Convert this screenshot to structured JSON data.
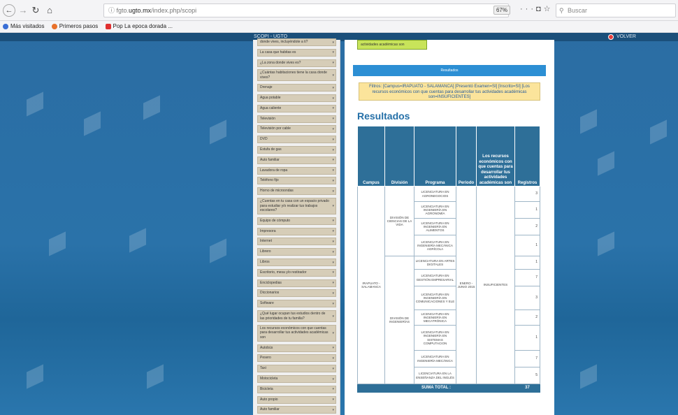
{
  "browser": {
    "url_prefix": "fgto.",
    "url_host": "ugto.mx",
    "url_path": "/index.php/scopi",
    "zoom": "67%",
    "search_placeholder": "Buscar",
    "bookmarks": [
      {
        "label": "Más visitados",
        "color": "#3a6fd6"
      },
      {
        "label": "Primeros pasos",
        "color": "#e8712a"
      },
      {
        "label": "Pop La epoca dorada ...",
        "color": "#e03030"
      }
    ]
  },
  "site": {
    "brand": "SCOPI - UGTO",
    "back_label": "VOLVER"
  },
  "filters": [
    "donde vives, incluyéndote a ti?",
    "La casa que habitas es",
    "¿La zona donde vives es?",
    "¿Cuántas habitaciones tiene la casa donde vives?",
    "Drenaje",
    "Agua potable",
    "Agua caliente",
    "Televisión",
    "Televisión por cable",
    "DVD",
    "Estufa de gas",
    "Auto familiar",
    "Lavadora de ropa",
    "Teléfono fijo",
    "Horno de microondas",
    "¿Cuentas en tu casa con un espacio privado para estudiar y/o realizar tus trabajos escolares?",
    "Equipo de cómputo",
    "Impresora",
    "Internet",
    "Librero",
    "Libros",
    "Escritorio, mesa y/o restirador",
    "Enciclopedias",
    "Diccionarios",
    "Software",
    "¿Qué lugar ocupan tus estudios dentro de las prioridades de tu familia?",
    "Los recursos económicos con que cuentas para desarrollar tus actividades académicas son",
    "Autobús",
    "Pesero",
    "Taxi",
    "Motocicleta",
    "Bicicleta",
    "Auto propio",
    "Auto familiar"
  ],
  "main": {
    "green_box_text": "actividades académicas son",
    "results_header": "Resultados",
    "filter_text": "Filtros: [Campus=IRAPUATO - SALAMANCA] [Presentó Examen=SI] [Inscrito=SI] [Los recursos económicos con que cuentas para desarrollar tus actividades académicas son=INSUFICIENTES]",
    "results_title": "Resultados",
    "table": {
      "headers": [
        "Campus",
        "División",
        "Programa",
        "Periodo",
        "Los recursos económicos con que cuentas para desarrollar tus actividades académicas son",
        "Registros"
      ],
      "campus": "IRAPUATO - SALAMANCA",
      "periodo": "ENERO - JUNIO 2015",
      "recursos": "INSUFICIENTES",
      "div1": "DIVISIÓN DE CIENCIAS DE LA VIDA",
      "div2": "DIVISIÓN DE INGENIERÍAS",
      "rows": [
        {
          "programa": "LICENCIATURA EN AGRONEGOCIOS",
          "registros": "3"
        },
        {
          "programa": "LICENCIATURA EN INGENIERÍA EN AGRONOMÍA",
          "registros": "1"
        },
        {
          "programa": "LICENCIATURA EN INGENIERÍA EN ALIMENTOS",
          "registros": "2"
        },
        {
          "programa": "LICENCIATURA EN INGENIERÍA MECÁNICA AGRÍCOLA",
          "registros": "1"
        },
        {
          "programa": "LICENCIATURA EN ARTES DIGITALES",
          "registros": "1"
        },
        {
          "programa": "LICENCIATURA EN GESTIÓN EMPRESARIAL",
          "registros": "7"
        },
        {
          "programa": "LICENCIATURA EN INGENIERÍA EN COMUNICACIONES Y ELE",
          "registros": "3"
        },
        {
          "programa": "LICENCIATURA EN INGENIERÍA EN MECATRÓNICA",
          "registros": "2"
        },
        {
          "programa": "LICENCIATURA EN INGENIERÍA EN SISTEMAS COMPUTACION",
          "registros": "1"
        },
        {
          "programa": "LICENCIATURA EN INGENIERÍA MECÁNICA",
          "registros": "7"
        },
        {
          "programa": "LICENCIATURA EN LA ENSEÑANZA DEL INGLÉS",
          "registros": "5"
        }
      ],
      "total_label": "SUMA TOTAL :",
      "total_value": "37"
    }
  }
}
